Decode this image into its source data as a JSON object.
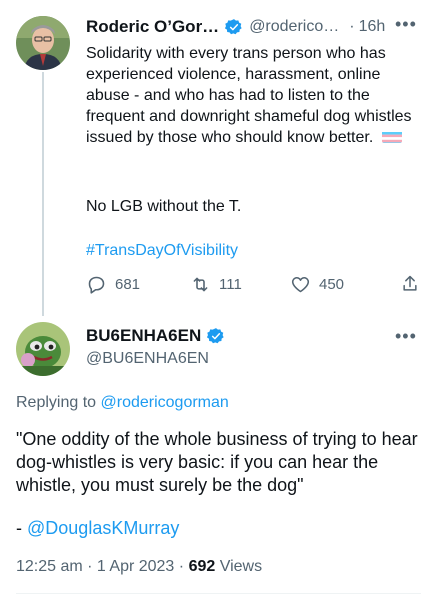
{
  "parent_tweet": {
    "display_name": "Roderic O’Gor…",
    "handle": "@roderico…",
    "separator": "·",
    "time": "16h",
    "text": "Solidarity with every trans person who has experienced violence, harassment, online abuse - and who has had to listen to the frequent and downright shameful dog whistles issued by those who should know better.",
    "text2": "No LGB without the T.",
    "hashtag": "#TransDayOfVisibility",
    "replies": "681",
    "retweets": "111",
    "likes": "450"
  },
  "main_tweet": {
    "display_name": "BU6ENHA6EN",
    "handle": "@BU6ENHA6EN",
    "replying_prefix": "Replying to",
    "replying_to": "@rodericogorman",
    "quote": "\"One oddity of the whole business of trying to hear dog-whistles is very basic: if you can hear the whistle, you must surely be the dog\"",
    "attribution_prefix": "-",
    "attribution": "@DouglasKMurray",
    "timestamp": "12:25 am · 1 Apr 2023 ·",
    "views_count": "692",
    "views_label": "Views"
  },
  "colors": {
    "accent": "#1d9bf0",
    "muted": "#536471",
    "text": "#0f1419",
    "divider": "#eff3f4"
  },
  "icons": [
    "verified-badge-icon",
    "trans-flag-icon",
    "reply-icon",
    "retweet-icon",
    "like-icon",
    "share-icon",
    "more-icon"
  ]
}
